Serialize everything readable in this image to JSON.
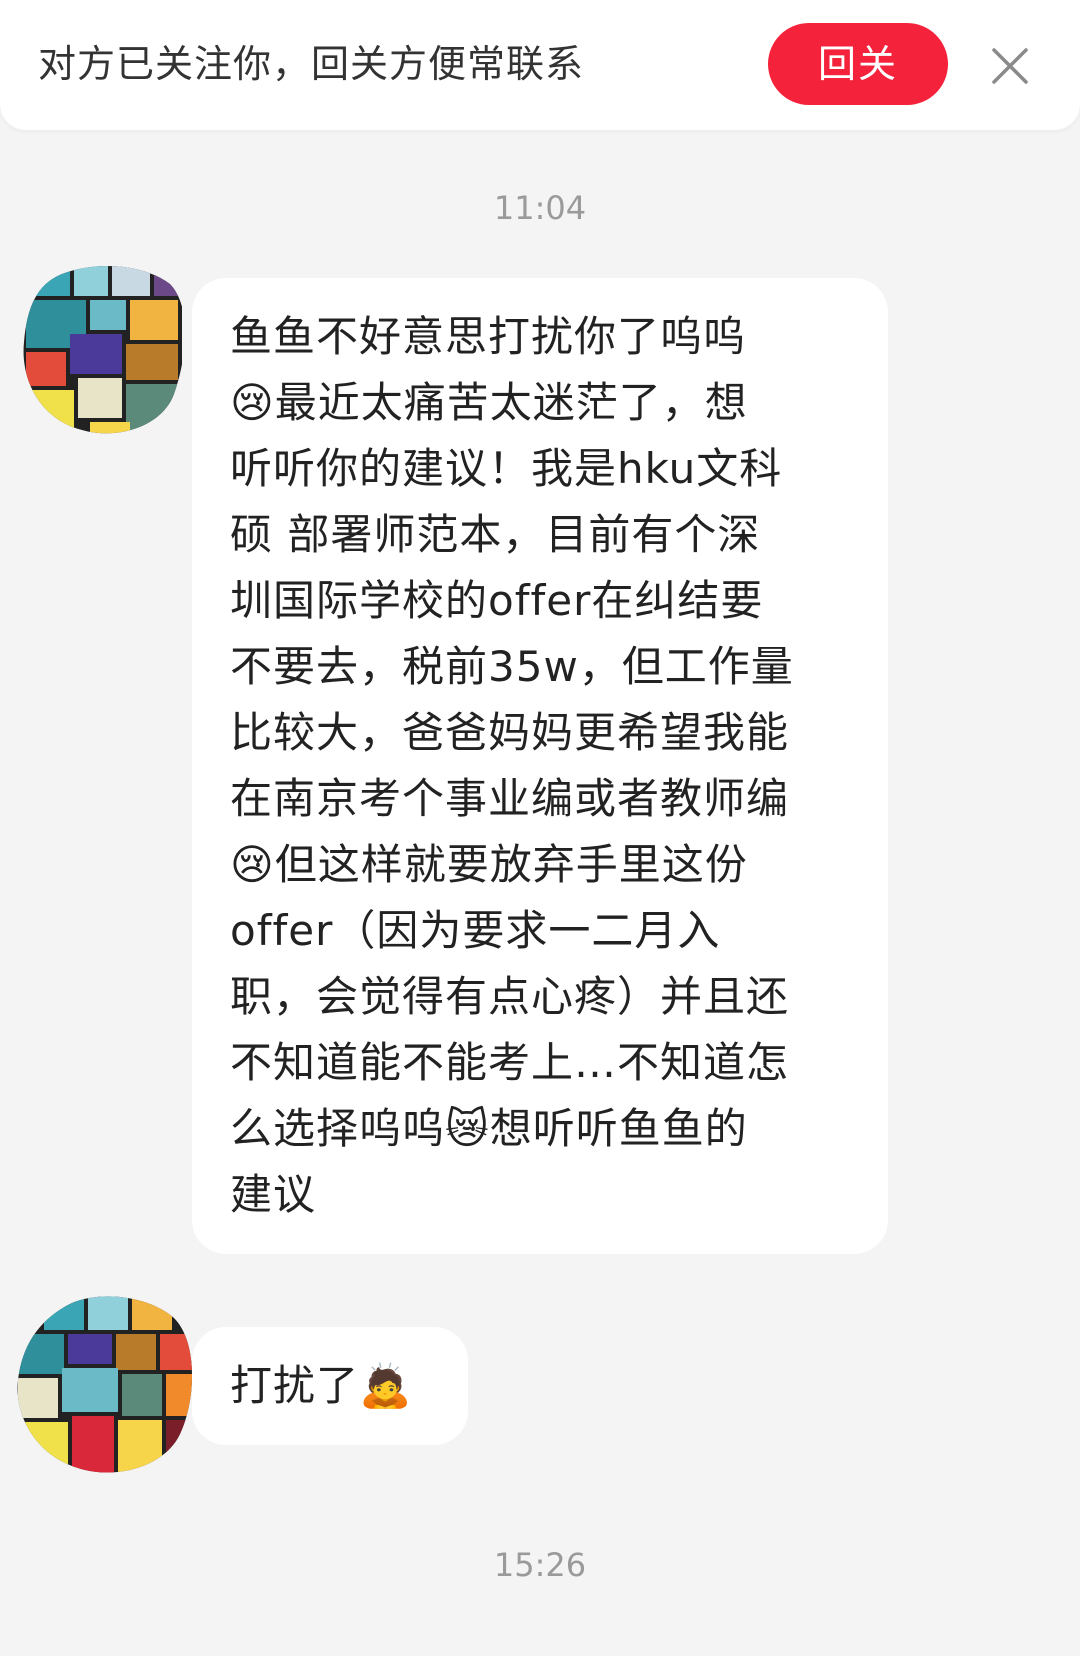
{
  "follow_banner": {
    "text": "对方已关注你，回关方便常联系",
    "follow_back_label": "回关",
    "close_icon": "close-icon"
  },
  "chat": {
    "timestamps": [
      "11:04",
      "15:26"
    ],
    "messages": [
      {
        "sender": "other",
        "avatar_icon": "mosaic-avatar",
        "text": "鱼鱼不好意思打扰你了呜呜\n😢最近太痛苦太迷茫了，想\n听听你的建议！我是hku文科\n硕 部署师范本，目前有个深\n圳国际学校的offer在纠结要\n不要去，税前35w，但工作量\n比较大，爸爸妈妈更希望我能\n在南京考个事业编或者教师编\n😢但这样就要放弃手里这份\noffer（因为要求一二月入\n职，会觉得有点心疼）并且还\n不知道能不能考上…不知道怎\n么选择呜呜😿想听听鱼鱼的\n建议"
      },
      {
        "sender": "other",
        "avatar_icon": "mosaic-avatar",
        "text": "打扰了🙇"
      }
    ]
  },
  "colors": {
    "background": "#f4f4f4",
    "accent": "#f5223b",
    "bubble": "#ffffff",
    "timestamp": "#9a9a9a"
  }
}
